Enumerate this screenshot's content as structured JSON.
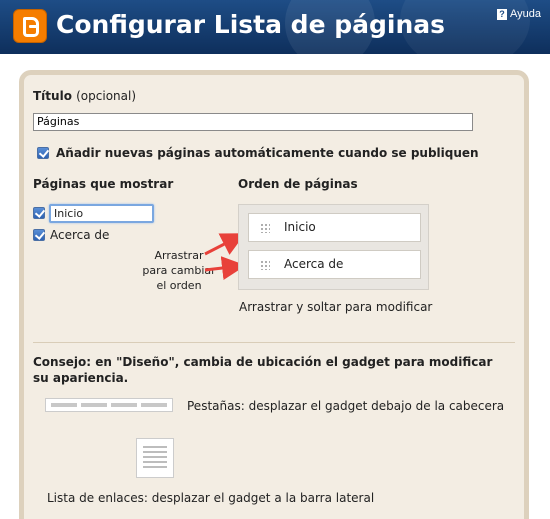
{
  "header": {
    "title": "Configurar Lista de páginas",
    "help_label": "Ayuda",
    "help_icon": "question-icon"
  },
  "form": {
    "title_label": "Título",
    "title_optional": "(opcional)",
    "title_value": "Páginas",
    "auto_add_label": "Añadir nuevas páginas automáticamente cuando se publiquen",
    "auto_add_checked": true
  },
  "pages_to_show": {
    "heading": "Páginas que mostrar",
    "items": [
      {
        "label": "Inicio",
        "checked": true,
        "editing": true
      },
      {
        "label": "Acerca de",
        "checked": true
      }
    ]
  },
  "drag_hint": [
    "Arrastrar",
    "para cambiar",
    "el orden"
  ],
  "page_order": {
    "heading": "Orden de páginas",
    "items": [
      "Inicio",
      "Acerca de"
    ],
    "instructions": "Arrastrar y soltar para modificar"
  },
  "tips": {
    "heading": "Consejo: en \"Diseño\", cambia de ubicación el gadget para modificar su apariencia.",
    "tabs_text": "Pestañas: desplazar el gadget debajo de la cabecera",
    "list_text": "Lista de enlaces: desplazar el gadget a la barra lateral"
  },
  "colors": {
    "header_bg": "#1e4d86",
    "logo": "#f57d00",
    "panel_bg": "#f3ede3",
    "panel_border": "#ddd1bd",
    "arrow": "#e8413a"
  }
}
